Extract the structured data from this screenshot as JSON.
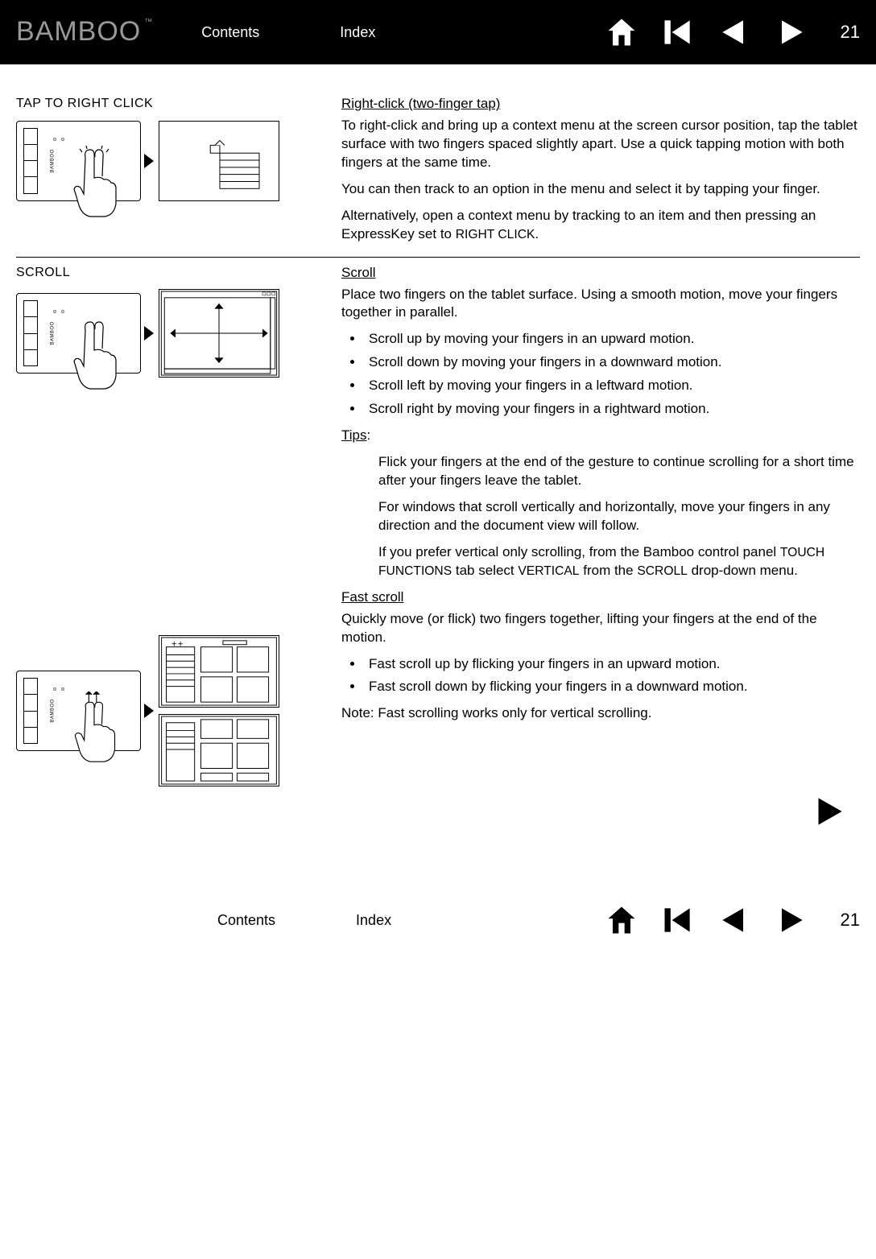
{
  "nav": {
    "contents": "Contents",
    "index": "Index",
    "page": "21"
  },
  "logo": {
    "text": "BAMBOO",
    "tm": "™"
  },
  "tablet_brand": "BAMBOO",
  "sec1": {
    "label": "Tap to right click",
    "heading": "Right-click (two-finger tap)",
    "p1": "To right-click and bring up a context menu at the screen cursor position, tap the tablet surface with two fingers spaced slightly apart.  Use a quick tapping motion with both fingers at the same time.",
    "p2": "You can then track to an option in the menu and select it by tapping your finger.",
    "p3a": "Alternatively, open a context menu by tracking to an item and then pressing an ExpressKey set to ",
    "p3b": "Right Click",
    "p3c": "."
  },
  "sec2": {
    "label": "Scroll",
    "heading": "Scroll",
    "p1": "Place two fingers on the tablet surface.  Using a smooth motion, move your fingers together in parallel.",
    "b1": "Scroll up by moving your fingers in an upward motion.",
    "b2": "Scroll down by moving your fingers in a downward motion.",
    "b3": "Scroll left by moving your fingers in a leftward motion.",
    "b4": "Scroll right by moving your fingers in a rightward motion.",
    "tips_label": "Tips",
    "tip1": "Flick your fingers at the end of the gesture to continue scrolling for a short time after your fingers leave the tablet.",
    "tip2": "For windows that scroll vertically and horizontally, move your fingers in any direction and the document view will follow.",
    "tip3a": "If you prefer vertical only scrolling, from the Bamboo control panel ",
    "tip3b": "Touch Functions",
    "tip3c": " tab select ",
    "tip3d": "Vertical",
    "tip3e": " from the ",
    "tip3f": "Scroll",
    "tip3g": " drop-down menu.",
    "heading2": "Fast scroll",
    "p2": "Quickly move (or flick) two fingers together, lifting your fingers at the end of the motion.",
    "fb1": "Fast scroll up by flicking your fingers in an upward motion.",
    "fb2": "Fast scroll down by flicking your fingers in a downward motion.",
    "note": "Note:  Fast scrolling works only for vertical scrolling."
  }
}
